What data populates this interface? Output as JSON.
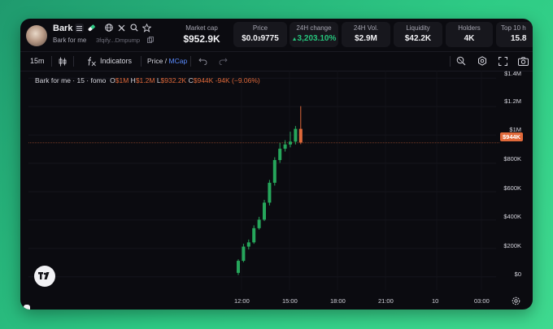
{
  "token": {
    "name": "Bark",
    "subtitle": "Bark for me",
    "address": "3fqify...Dmpump"
  },
  "stats": [
    {
      "label": "Market cap",
      "value": "$952.9K"
    },
    {
      "label": "Price",
      "value_main": "$0.0",
      "value_sub": "3",
      "value_tail": "9775"
    },
    {
      "label": "24H change",
      "value": "3,203.10%",
      "arrow": "▲"
    },
    {
      "label": "24H Vol.",
      "value": "$2.9M"
    },
    {
      "label": "Liquidity",
      "value": "$42.2K"
    },
    {
      "label": "Holders",
      "value": "4K"
    },
    {
      "label": "Top 10 h",
      "value": "15.8"
    }
  ],
  "toolbar": {
    "interval": "15m",
    "indicators": "Indicators",
    "price": "Price",
    "slash": "/",
    "mcap": "MCap"
  },
  "legend": {
    "title": "Bark for me · 15 · fomo",
    "o_key": "O",
    "o_val": "$1M",
    "h_key": "H",
    "h_val": "$1.2M",
    "l_key": "L",
    "l_val": "$932.2K",
    "c_key": "C",
    "c_val": "$944K",
    "change": "-94K (−9.06%)"
  },
  "colors": {
    "up": "#26a65b",
    "down": "#e0693a",
    "accent": "#5b8cff"
  },
  "current_price_label": "$944K",
  "chart_data": {
    "type": "candlestick",
    "y_unit": "USD market cap",
    "ylim": [
      -50000,
      1450000
    ],
    "y_ticks": [
      "$1.4M",
      "$1.2M",
      "$1M",
      "$800K",
      "$600K",
      "$400K",
      "$200K",
      "$0"
    ],
    "y_tick_values": [
      1400000,
      1200000,
      1000000,
      800000,
      600000,
      400000,
      200000,
      0
    ],
    "x_ticks": [
      "12:00",
      "15:00",
      "18:00",
      "21:00",
      "10",
      "03:00"
    ],
    "current_value": 944000,
    "candles": [
      {
        "o": 25000,
        "h": 120000,
        "l": 10000,
        "c": 110000
      },
      {
        "o": 110000,
        "h": 230000,
        "l": 100000,
        "c": 210000
      },
      {
        "o": 210000,
        "h": 260000,
        "l": 190000,
        "c": 240000
      },
      {
        "o": 240000,
        "h": 360000,
        "l": 230000,
        "c": 340000
      },
      {
        "o": 340000,
        "h": 420000,
        "l": 330000,
        "c": 400000
      },
      {
        "o": 400000,
        "h": 540000,
        "l": 390000,
        "c": 520000
      },
      {
        "o": 520000,
        "h": 680000,
        "l": 500000,
        "c": 660000
      },
      {
        "o": 660000,
        "h": 840000,
        "l": 640000,
        "c": 820000
      },
      {
        "o": 820000,
        "h": 940000,
        "l": 800000,
        "c": 900000
      },
      {
        "o": 900000,
        "h": 960000,
        "l": 880000,
        "c": 930000
      },
      {
        "o": 930000,
        "h": 1020000,
        "l": 910000,
        "c": 950000
      },
      {
        "o": 950000,
        "h": 1060000,
        "l": 930000,
        "c": 1040000
      },
      {
        "o": 1040000,
        "h": 1200000,
        "l": 932200,
        "c": 944000
      }
    ]
  }
}
